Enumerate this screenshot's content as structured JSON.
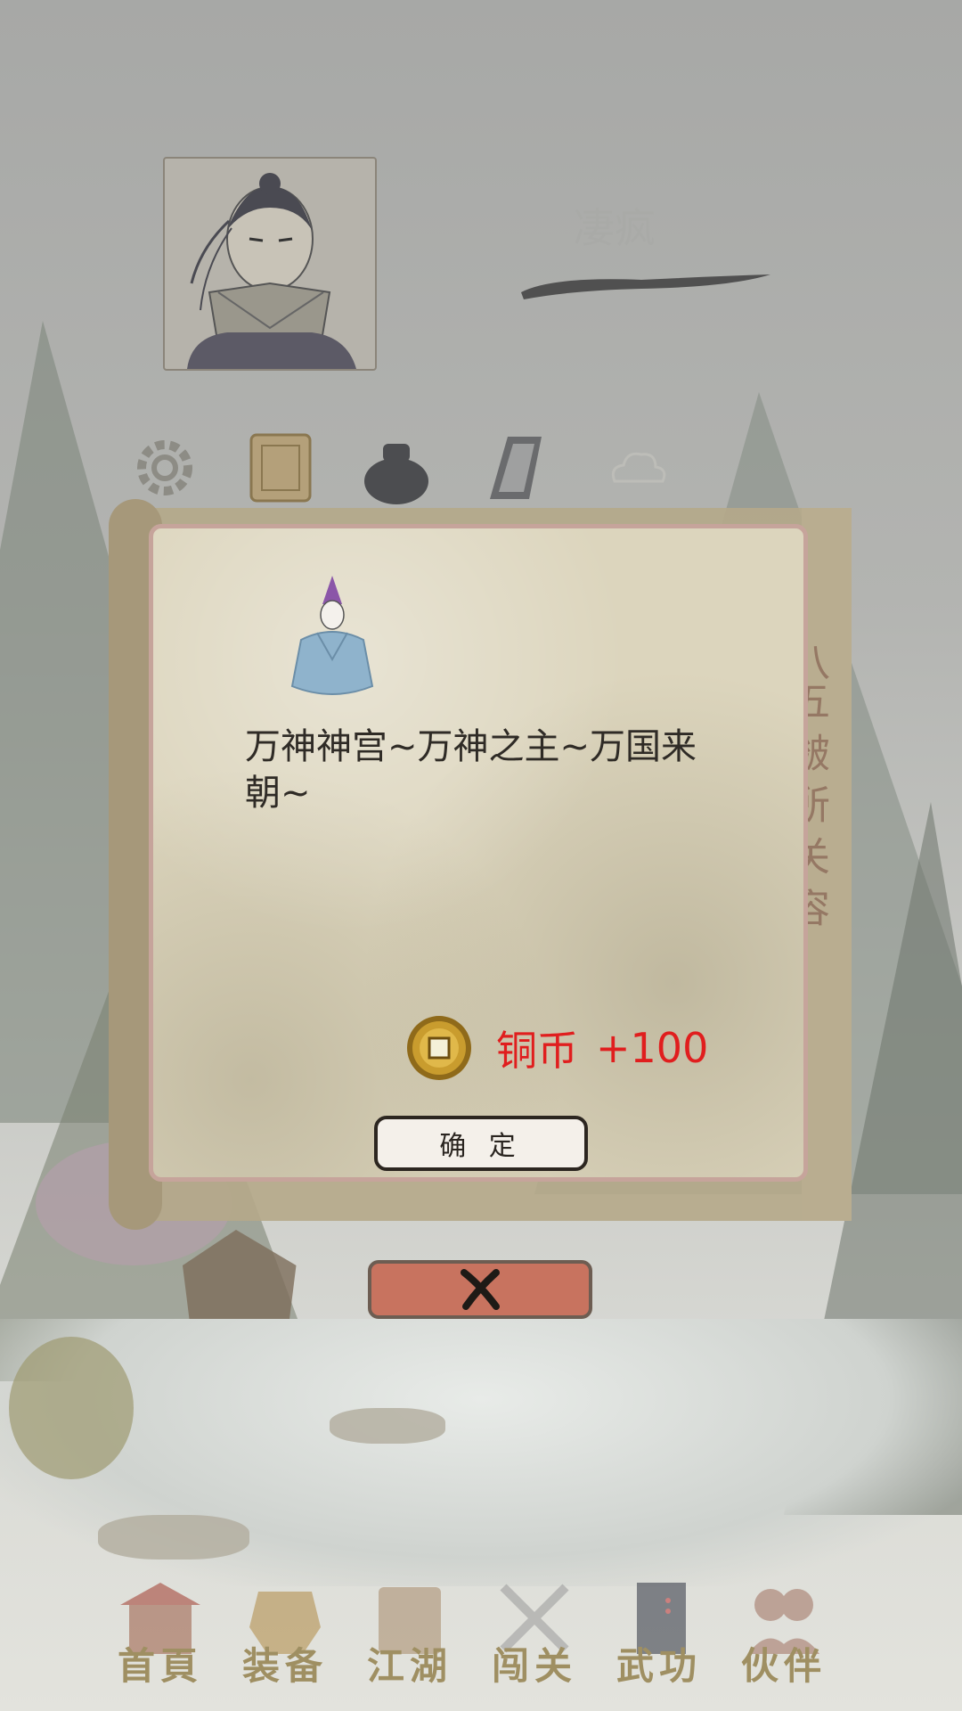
{
  "player": {
    "name": "凄疯"
  },
  "top_icons": [
    "settings-icon",
    "scroll-book-icon",
    "treasure-pot-icon",
    "phone-tablet-icon",
    "cloud-icon"
  ],
  "background_scroll_text": "八五 皴 所 关 容",
  "dialog": {
    "message": "万神神宫~万神之主~万国来朝~",
    "reward": {
      "label": "铜币",
      "amount": "+100",
      "color": "#e01e1e"
    },
    "confirm_label": "确 定"
  },
  "close_button": {
    "icon": "close-x-icon"
  },
  "bottom_nav": [
    {
      "label": "首頁",
      "icon": "home-pavilion-icon"
    },
    {
      "label": "装备",
      "icon": "armor-icon"
    },
    {
      "label": "江湖",
      "icon": "scroll-map-icon"
    },
    {
      "label": "闯关",
      "icon": "crossed-swords-icon"
    },
    {
      "label": "武功",
      "icon": "martial-book-icon"
    },
    {
      "label": "伙伴",
      "icon": "partners-icon"
    }
  ]
}
